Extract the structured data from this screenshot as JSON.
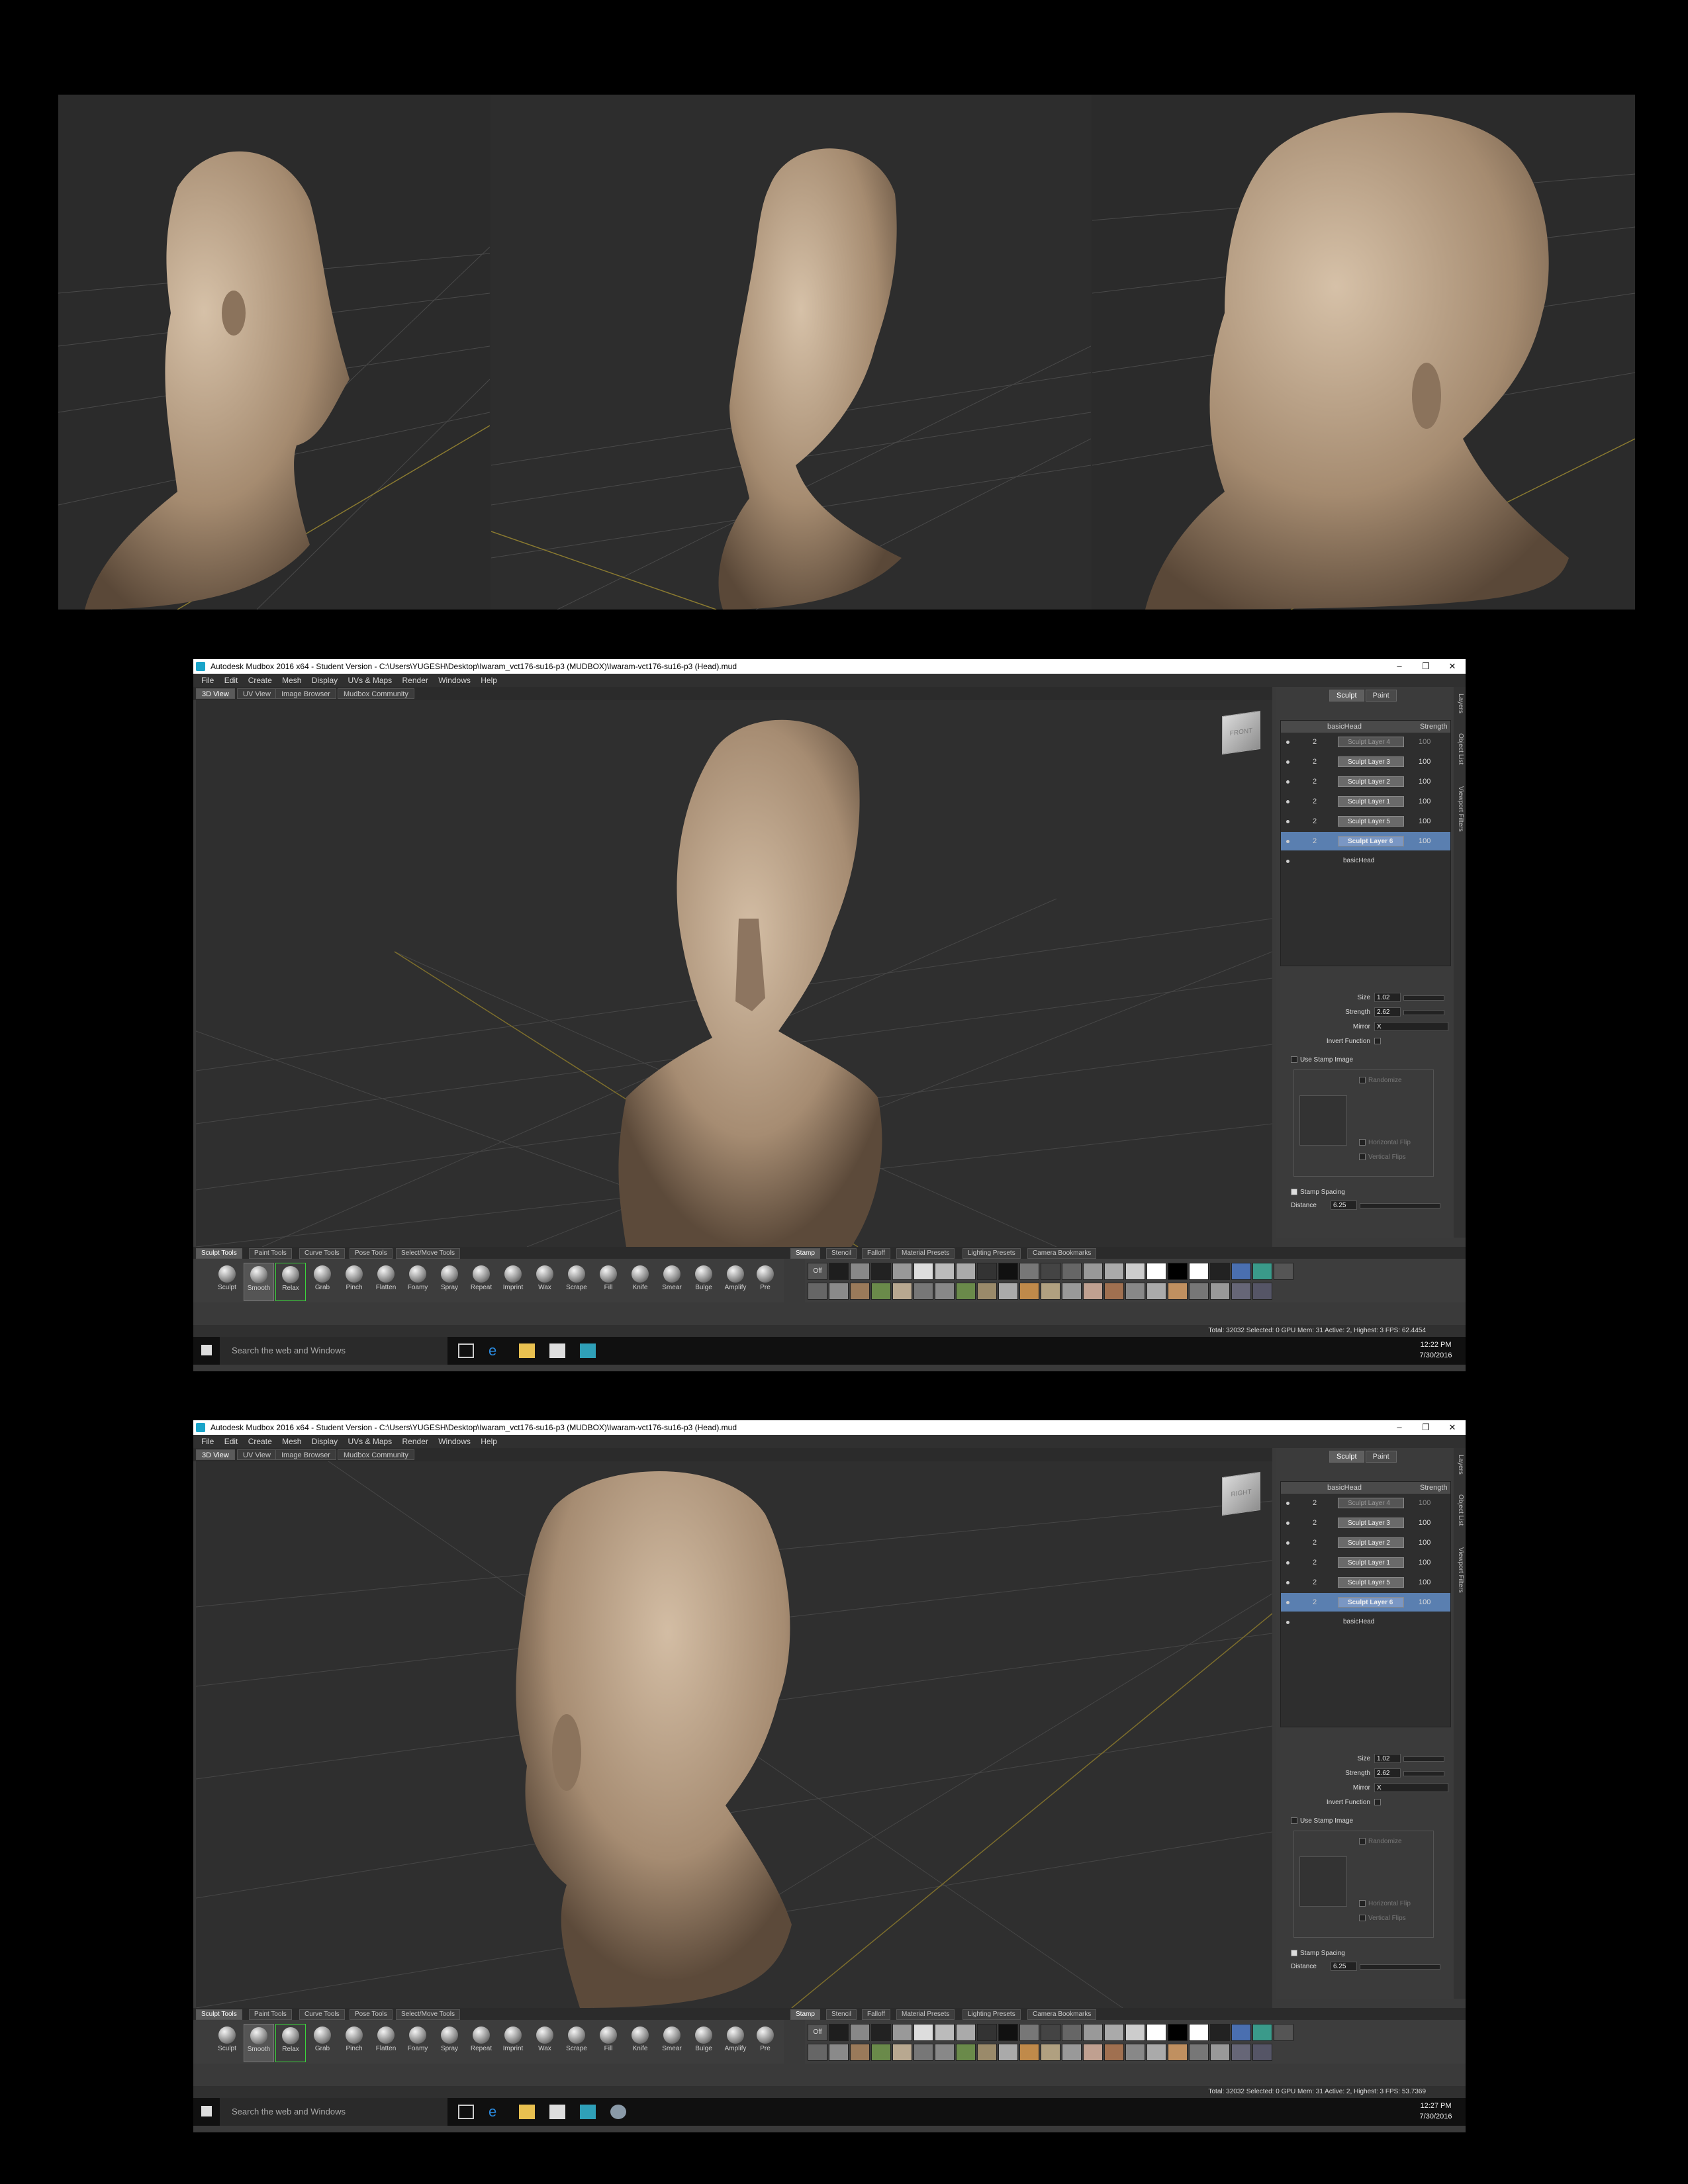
{
  "window1": {
    "title": "Autodesk Mudbox 2016 x64 - Student Version - C:\\Users\\YUGESH\\Desktop\\Iwaram_vct176-su16-p3 (MUDBOX)\\Iwaram-vct176-su16-p3 (Head).mud",
    "menu": [
      "File",
      "Edit",
      "Create",
      "Mesh",
      "Display",
      "UVs & Maps",
      "Render",
      "Windows",
      "Help"
    ],
    "view_tabs": [
      "3D View",
      "UV View",
      "Image Browser",
      "Mudbox Community"
    ],
    "navcube_label": "FRONT",
    "panel_tabs": [
      "Sculpt",
      "Paint"
    ],
    "side_tabs": [
      "Layers",
      "Object List",
      "Viewport Filters"
    ],
    "layers_header": {
      "name": "basicHead",
      "strength": "Strength"
    },
    "layers": [
      {
        "level": "2",
        "name": "Sculpt Layer 4",
        "strength": "100",
        "state": "dim"
      },
      {
        "level": "2",
        "name": "Sculpt Layer 3",
        "strength": "100",
        "state": "normal"
      },
      {
        "level": "2",
        "name": "Sculpt Layer 2",
        "strength": "100",
        "state": "normal"
      },
      {
        "level": "2",
        "name": "Sculpt Layer 1",
        "strength": "100",
        "state": "normal"
      },
      {
        "level": "2",
        "name": "Sculpt Layer 5",
        "strength": "100",
        "state": "normal"
      },
      {
        "level": "2",
        "name": "Sculpt Layer 6",
        "strength": "100",
        "state": "selected"
      }
    ],
    "base_layer": "basicHead",
    "props": {
      "size_label": "Size",
      "size": "1.02",
      "strength_label": "Strength",
      "strength": "2.62",
      "mirror_label": "Mirror",
      "mirror": "X",
      "invert_label": "Invert Function",
      "use_stamp_label": "Use Stamp Image",
      "randomize_label": "Randomize",
      "hflip_label": "Horizontal Flip",
      "vflip_label": "Vertical Flips",
      "spacing_label": "Stamp Spacing",
      "distance_label": "Distance",
      "distance": "6.25"
    },
    "tool_tabs": [
      "Sculpt Tools",
      "Paint Tools",
      "Curve Tools",
      "Pose Tools",
      "Select/Move Tools"
    ],
    "tools": [
      "Sculpt",
      "Smooth",
      "Relax",
      "Grab",
      "Pinch",
      "Flatten",
      "Foamy",
      "Spray",
      "Repeat",
      "Imprint",
      "Wax",
      "Scrape",
      "Fill",
      "Knife",
      "Smear",
      "Bulge",
      "Amplify",
      "Pre"
    ],
    "stamp_tabs": [
      "Stamp",
      "Stencil",
      "Falloff",
      "Material Presets",
      "Lighting Presets",
      "Camera Bookmarks"
    ],
    "stamp_off": "Off",
    "status": "Total: 32032  Selected: 0 GPU Mem: 31  Active: 2, Highest: 3  FPS: 62.4454",
    "search_placeholder": "Search the web and Windows",
    "time": "12:22 PM",
    "date": "7/30/2016"
  },
  "window2": {
    "title": "Autodesk Mudbox 2016 x64 - Student Version - C:\\Users\\YUGESH\\Desktop\\Iwaram_vct176-su16-p3 (MUDBOX)\\Iwaram-vct176-su16-p3 (Head).mud",
    "navcube_label": "RIGHT",
    "status": "Total: 32032  Selected: 0 GPU Mem: 31  Active: 2, Highest: 3  FPS: 53.7369",
    "time": "12:27 PM",
    "date": "7/30/2016"
  },
  "colors": {
    "viewport_bg": "#2f2f2f",
    "clay": "#b39a80",
    "selection": "#5a7fb0",
    "relax_highlight": "#3bd33b"
  }
}
